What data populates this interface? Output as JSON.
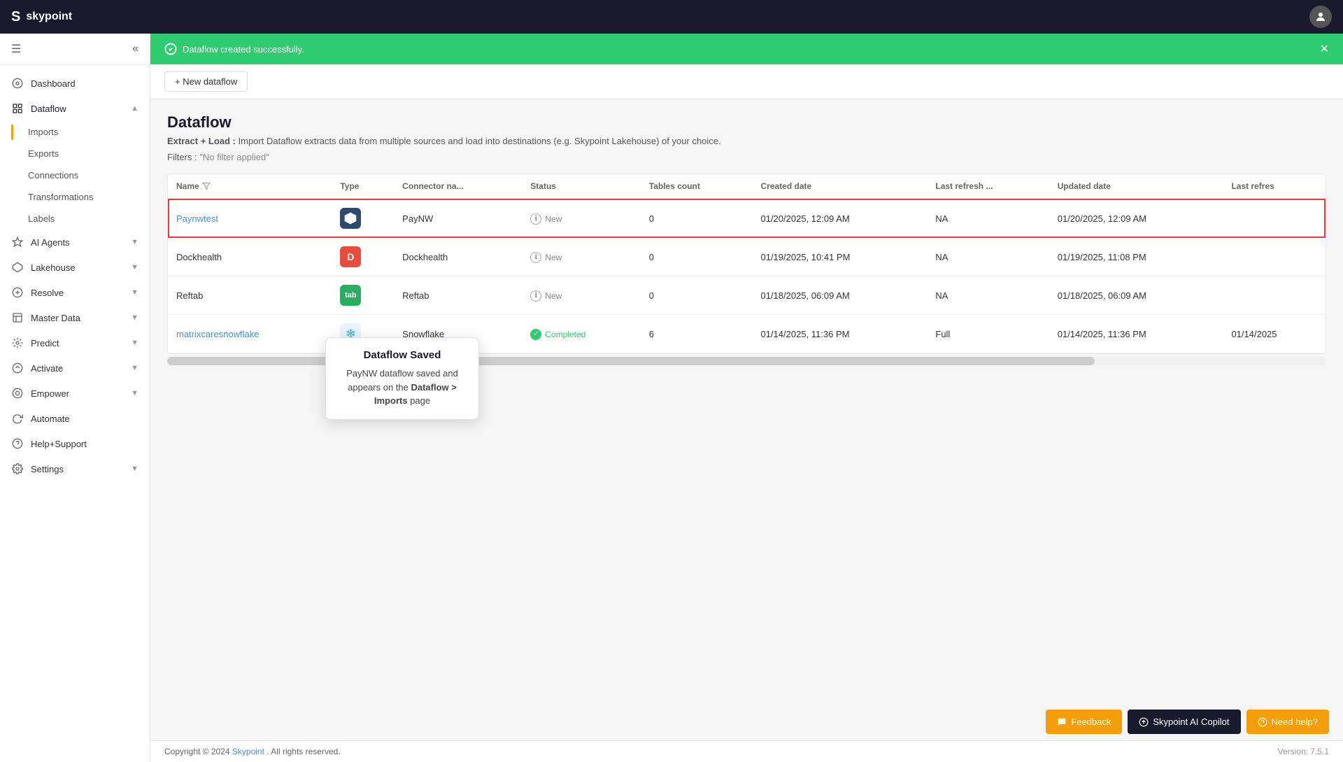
{
  "app": {
    "name": "skypoint",
    "logo_letter": "S"
  },
  "topbar": {
    "title": "skypoint"
  },
  "success_banner": {
    "message": "Dataflow created successfully.",
    "icon": "✓"
  },
  "toolbar": {
    "new_dataflow_label": "+ New dataflow"
  },
  "page": {
    "title": "Dataflow",
    "subtitle_bold": "Extract + Load :",
    "subtitle_text": " Import Dataflow extracts data from multiple sources and load into destinations (e.g. Skypoint Lakehouse) of your choice.",
    "filters_label": "Filters :",
    "filters_value": "\"No filter applied\""
  },
  "table": {
    "columns": [
      "Name",
      "Type",
      "Connector na...",
      "Status",
      "Tables count",
      "Created date",
      "Last refresh ...",
      "Updated date",
      "Last refres"
    ],
    "rows": [
      {
        "name": "Paynwtest",
        "connector_type": "PayNW",
        "connector_icon": "hexagon",
        "status": "New",
        "tables_count": "0",
        "created_date": "01/20/2025, 12:09 AM",
        "last_refresh": "NA",
        "updated_date": "01/20/2025, 12:09 AM",
        "last_refres": "",
        "highlighted": true
      },
      {
        "name": "Dockhealth",
        "connector_type": "Dockhealth",
        "connector_icon": "D",
        "status": "New",
        "tables_count": "0",
        "created_date": "01/19/2025, 10:41 PM",
        "last_refresh": "NA",
        "updated_date": "01/19/2025, 11:08 PM",
        "last_refres": "",
        "highlighted": false
      },
      {
        "name": "Reftab",
        "connector_type": "Reftab",
        "connector_icon": "R",
        "status": "New",
        "tables_count": "0",
        "created_date": "01/18/2025, 06:09 AM",
        "last_refresh": "NA",
        "updated_date": "01/18/2025, 06:09 AM",
        "last_refres": "",
        "highlighted": false
      },
      {
        "name": "matrixcaresnowflake",
        "connector_type": "Snowflake",
        "connector_icon": "❄",
        "status": "Completed",
        "tables_count": "6",
        "created_date": "01/14/2025, 11:36 PM",
        "last_refresh": "Full",
        "updated_date": "01/14/2025, 11:36 PM",
        "last_refres": "01/14/2025",
        "highlighted": false
      }
    ]
  },
  "tooltip": {
    "title": "Dataflow Saved",
    "body_text": "PayNW dataflow saved and appears on the",
    "body_link": "Dataflow > Imports",
    "body_suffix": "page"
  },
  "sidebar": {
    "menu_icon": "☰",
    "items": [
      {
        "id": "dashboard",
        "label": "Dashboard",
        "icon": "⊙",
        "expandable": false
      },
      {
        "id": "dataflow",
        "label": "Dataflow",
        "icon": "⊡",
        "expandable": true,
        "expanded": true
      },
      {
        "id": "ai-agents",
        "label": "AI Agents",
        "icon": "✦",
        "expandable": true
      },
      {
        "id": "lakehouse",
        "label": "Lakehouse",
        "icon": "⬡",
        "expandable": true
      },
      {
        "id": "resolve",
        "label": "Resolve",
        "icon": "⊕",
        "expandable": true
      },
      {
        "id": "master-data",
        "label": "Master Data",
        "icon": "◫",
        "expandable": true
      },
      {
        "id": "predict",
        "label": "Predict",
        "icon": "⊛",
        "expandable": true
      },
      {
        "id": "activate",
        "label": "Activate",
        "icon": "✺",
        "expandable": true
      },
      {
        "id": "empower",
        "label": "Empower",
        "icon": "◎",
        "expandable": true
      },
      {
        "id": "automate",
        "label": "Automate",
        "icon": "↻",
        "expandable": false
      },
      {
        "id": "help-support",
        "label": "Help+Support",
        "icon": "?",
        "expandable": false
      },
      {
        "id": "settings",
        "label": "Settings",
        "icon": "⚙",
        "expandable": true
      }
    ],
    "dataflow_sub": [
      {
        "id": "imports",
        "label": "Imports",
        "active": true
      },
      {
        "id": "exports",
        "label": "Exports"
      },
      {
        "id": "connections",
        "label": "Connections"
      },
      {
        "id": "transformations",
        "label": "Transformations"
      },
      {
        "id": "labels",
        "label": "Labels"
      }
    ]
  },
  "bottom_buttons": {
    "feedback": "Feedback",
    "copilot": "Skypoint AI Copilot",
    "help": "Need help?"
  },
  "footer": {
    "copyright": "Copyright © 2024",
    "brand": "Skypoint",
    "rights": ". All rights reserved.",
    "version": "Version: 7.5.1"
  }
}
